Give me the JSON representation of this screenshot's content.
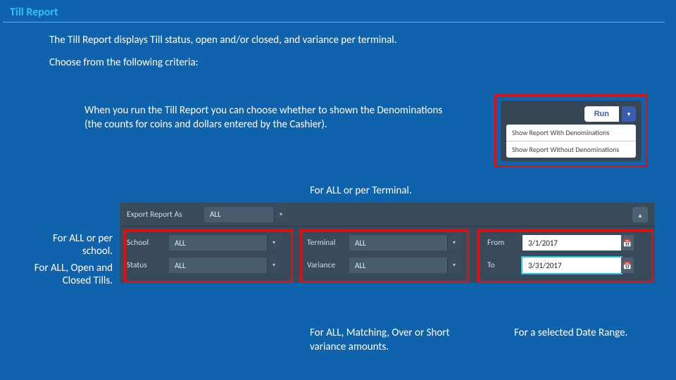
{
  "title": "Till Report",
  "intro": {
    "line1": "The Till Report displays Till status, open and/or closed, and variance per terminal.",
    "line2": "Choose from the following criteria:"
  },
  "denom_note": "When you run the Till Report you can choose whether to shown the Denominations (the counts for coins and dollars entered by the Cashier).",
  "run": {
    "button": "Run",
    "menu": [
      "Show Report With Denominations",
      "Show Report Without Denominations"
    ]
  },
  "captions": {
    "terminal": "For ALL or per Terminal.",
    "school": "For ALL or per school.",
    "tills": "For ALL, Open and Closed Tills.",
    "variance": "For ALL, Matching, Over or Short variance amounts.",
    "date": "For a selected Date Range."
  },
  "filters": {
    "export_label": "Export Report As",
    "export_value": "ALL",
    "school": {
      "label": "School",
      "value": "ALL"
    },
    "status": {
      "label": "Status",
      "value": "ALL"
    },
    "terminal": {
      "label": "Terminal",
      "value": "ALL"
    },
    "variance": {
      "label": "Variance",
      "value": "ALL"
    },
    "from": {
      "label": "From",
      "value": "3/1/2017"
    },
    "to": {
      "label": "To",
      "value": "3/31/2017"
    }
  }
}
